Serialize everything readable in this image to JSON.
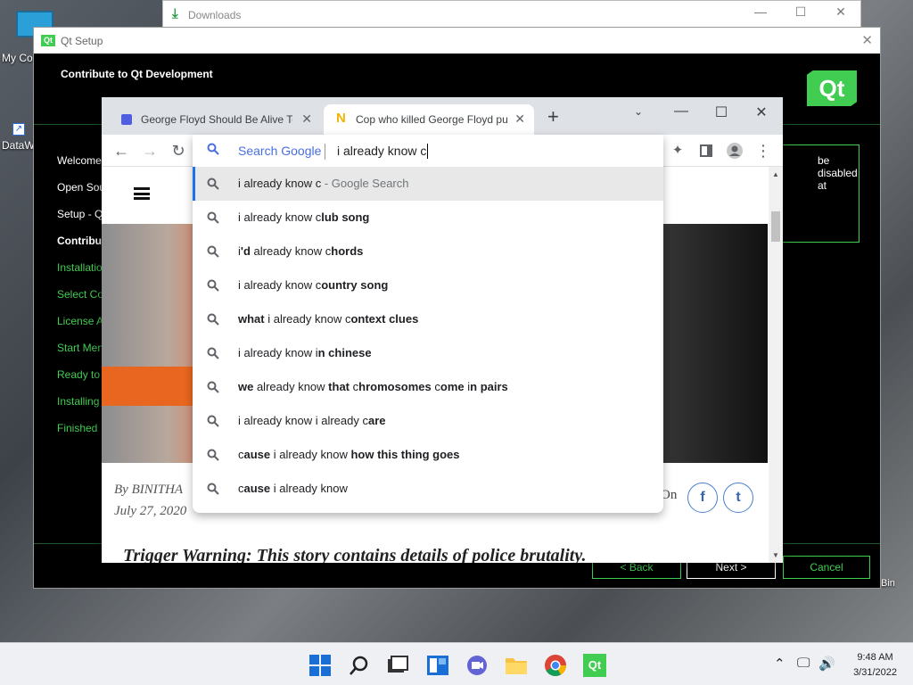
{
  "desktop": {
    "icons": [
      {
        "label": "My Co",
        "icon": "monitor-icon"
      },
      {
        "label": "DataW",
        "icon": "shortcut-icon"
      }
    ],
    "recycle_bin_label": "Bin"
  },
  "downloads_window": {
    "title": "Downloads",
    "controls": [
      "—",
      "☐",
      "✕"
    ]
  },
  "qt_setup": {
    "title": "Qt Setup",
    "badge": "Qt",
    "header": "Contribute to Qt Development",
    "logo_text": "Qt",
    "steps": [
      {
        "label": "Welcome",
        "state": "done"
      },
      {
        "label": "Open Sou",
        "state": "done"
      },
      {
        "label": "Setup - Q",
        "state": "done"
      },
      {
        "label": "Contributi",
        "state": "current"
      },
      {
        "label": "Installatio",
        "state": "pending"
      },
      {
        "label": "Select Co",
        "state": "pending"
      },
      {
        "label": "License A",
        "state": "pending"
      },
      {
        "label": "Start Men",
        "state": "pending"
      },
      {
        "label": "Ready to I",
        "state": "pending"
      },
      {
        "label": "Installing",
        "state": "pending"
      },
      {
        "label": "Finished",
        "state": "pending"
      }
    ],
    "right_box_text": "be disabled at",
    "buttons": {
      "back": "< Back",
      "next": "Next >",
      "cancel": "Cancel"
    },
    "accent": "#41cd52"
  },
  "chrome": {
    "tabs": [
      {
        "title": "George Floyd Should Be Alive To",
        "favicon": "blue-square-icon",
        "active": false
      },
      {
        "title": "Cop who killed George Floyd pul",
        "favicon": "n-logo-icon",
        "active": true
      }
    ],
    "new_tab_label": "+",
    "omnibox": {
      "engine_label": "Search Google",
      "query": "i already know c",
      "suggestions": [
        {
          "parts": [
            {
              "t": "i already know c",
              "b": false
            },
            {
              "t": " - Google Search",
              "b": false,
              "suffix": true
            }
          ],
          "selected": true
        },
        {
          "parts": [
            {
              "t": "i already know c",
              "b": false
            },
            {
              "t": "lub song",
              "b": true
            }
          ]
        },
        {
          "parts": [
            {
              "t": "i",
              "b": false
            },
            {
              "t": "'d",
              "b": true
            },
            {
              "t": " already know c",
              "b": false
            },
            {
              "t": "hords",
              "b": true
            }
          ]
        },
        {
          "parts": [
            {
              "t": "i already know c",
              "b": false
            },
            {
              "t": "ountry song",
              "b": true
            }
          ]
        },
        {
          "parts": [
            {
              "t": "what",
              "b": true
            },
            {
              "t": " i already know c",
              "b": false
            },
            {
              "t": "ontext clues",
              "b": true
            }
          ]
        },
        {
          "parts": [
            {
              "t": "i already know i",
              "b": false
            },
            {
              "t": "n chinese",
              "b": true
            }
          ]
        },
        {
          "parts": [
            {
              "t": "we",
              "b": true
            },
            {
              "t": " already know ",
              "b": false
            },
            {
              "t": "that",
              "b": true
            },
            {
              "t": " c",
              "b": false
            },
            {
              "t": "hromosomes",
              "b": true
            },
            {
              "t": " c",
              "b": false
            },
            {
              "t": "ome",
              "b": true
            },
            {
              "t": " i",
              "b": false
            },
            {
              "t": "n",
              "b": true
            },
            {
              "t": " pairs",
              "b": true
            }
          ]
        },
        {
          "parts": [
            {
              "t": "i already know i already c",
              "b": false
            },
            {
              "t": "are",
              "b": true
            }
          ]
        },
        {
          "parts": [
            {
              "t": "c",
              "b": false
            },
            {
              "t": "ause",
              "b": true
            },
            {
              "t": " i already know ",
              "b": false
            },
            {
              "t": "how this thing goes",
              "b": true
            }
          ]
        },
        {
          "parts": [
            {
              "t": "c",
              "b": false
            },
            {
              "t": "ause",
              "b": true
            },
            {
              "t": " i already know",
              "b": false
            }
          ]
        }
      ]
    },
    "page": {
      "byline": "By BINITHA",
      "date": "July 27, 2020",
      "share_label": "On",
      "social": [
        "f",
        "t"
      ],
      "warning": "Trigger Warning: This story contains details of police brutality."
    }
  },
  "taskbar": {
    "apps": [
      "windows-start-icon",
      "search-icon",
      "task-view-icon",
      "widgets-icon",
      "chat-icon",
      "file-explorer-icon",
      "chrome-icon",
      "qt-icon"
    ],
    "qt_app_label": "Qt",
    "time": "9:48 AM",
    "date": "3/31/2022"
  }
}
